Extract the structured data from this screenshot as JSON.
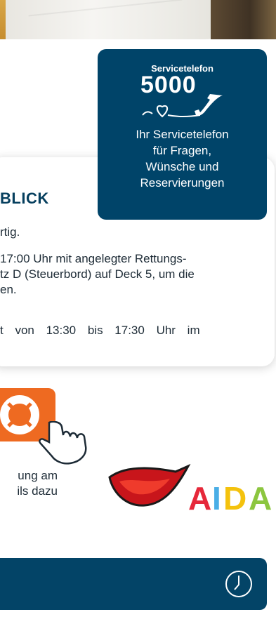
{
  "photo": {
    "description_icon": "photo-strip"
  },
  "overview_card": {
    "heading": "BLICK",
    "line1": "rtig.",
    "line2": "17:00 Uhr mit angelegter Rettungs-\ntz D (Steuerbord) auf Deck 5, um die\nen.",
    "line3": "t  von  13:30  bis  17:30  Uhr  im"
  },
  "service": {
    "title": "Servicetelefon",
    "number": "5000",
    "description": "Ihr Servicetelefon\nfür Fragen,\nWünsche und\nReservierungen"
  },
  "safety": {
    "text": "ung am\nils dazu"
  },
  "logo": {
    "text": "AIDA",
    "colors": [
      "#e6283a",
      "#4aaee6",
      "#f4c20d",
      "#8cc63f"
    ]
  },
  "colors": {
    "navy": "#004469",
    "orange": "#ee6a21"
  },
  "bottom_bar": {
    "icon": "clock-icon"
  }
}
